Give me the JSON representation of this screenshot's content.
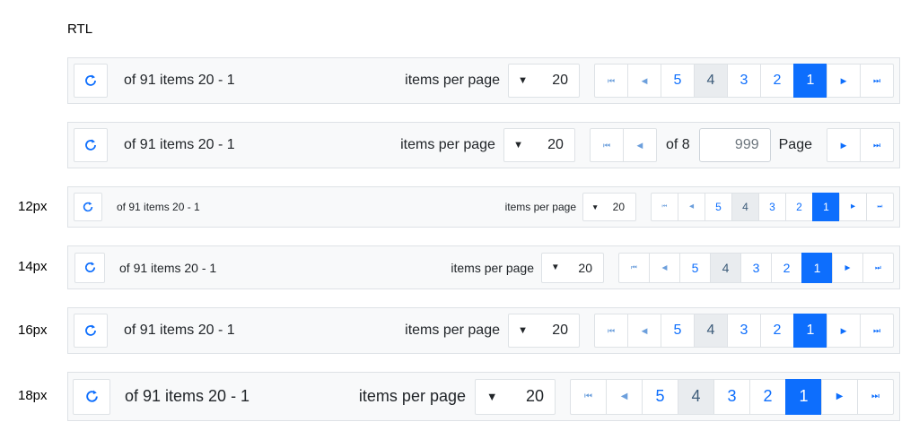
{
  "heading": "RTL",
  "sizes": [
    "12px",
    "14px",
    "16px",
    "18px"
  ],
  "pager": {
    "info": "of 91 items 20 - 1",
    "items_per_page_label": "items per page",
    "page_size": "20",
    "pages": [
      "5",
      "4",
      "3",
      "2",
      "1"
    ],
    "selected_page": "1",
    "hover_page": "4"
  },
  "input_pager": {
    "of_text": "of 8",
    "page_input_value": "999",
    "page_label": "Page"
  },
  "icons": {
    "first": "first-page-icon",
    "prev": "previous-page-icon",
    "next": "next-page-icon",
    "last": "last-page-icon",
    "refresh": "refresh-icon"
  },
  "colors": {
    "accent": "#0d6efd",
    "hover": "#e9ecef",
    "border": "#dee2e6"
  }
}
